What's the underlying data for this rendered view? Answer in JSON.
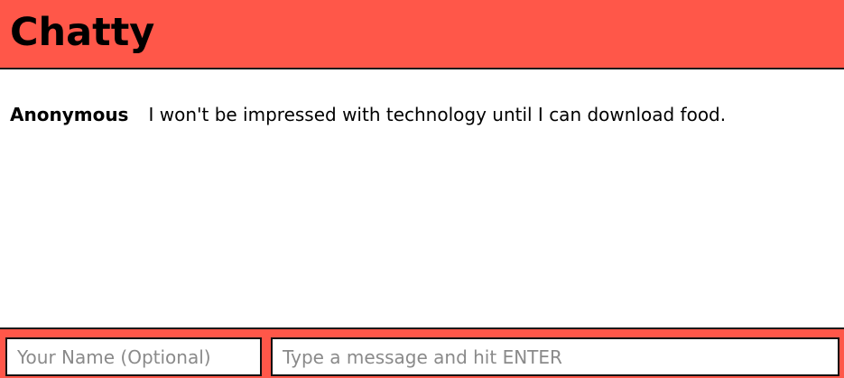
{
  "header": {
    "title": "Chatty"
  },
  "messages": [
    {
      "author": "Anonymous",
      "text": "I won't be impressed with technology until I can download food."
    }
  ],
  "composer": {
    "name_value": "",
    "name_placeholder": "Your Name (Optional)",
    "message_value": "",
    "message_placeholder": "Type a message and hit ENTER"
  },
  "colors": {
    "accent": "#ff5749",
    "border": "#1a1a1a",
    "background": "#ffffff"
  }
}
